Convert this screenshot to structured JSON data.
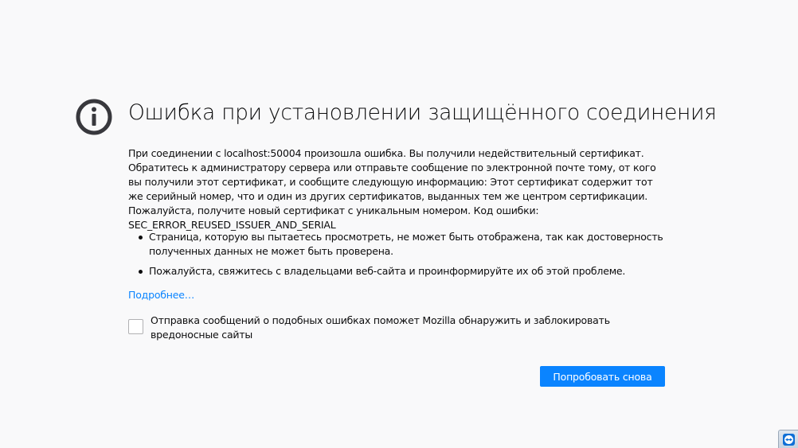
{
  "icon": "info-icon",
  "title": "Ошибка при установлении защищённого соединения",
  "description": "При соединении с localhost:50004 произошла ошибка. Вы получили недействительный сертификат. Обратитесь к администратору сервера или отправьте сообщение по электронной почте тому, от кого вы получили этот сертификат, и сообщите следующую информацию: Этот сертификат содержит тот же серийный номер, что и один из других сертификатов, выданных тем же центром сертификации. Пожалуйста, получите новый сертификат с уникальным номером. Код ошибки: SEC_ERROR_REUSED_ISSUER_AND_SERIAL",
  "reasons": [
    "Страница, которую вы пытаетесь просмотреть, не может быть отображена, так как достоверность полученных данных не может быть проверена.",
    "Пожалуйста, свяжитесь с владельцами веб-сайта и проинформируйте их об этой проблеме."
  ],
  "advanced_link": "Подробнее…",
  "report": {
    "checked": false,
    "label": "Отправка сообщений о подобных ошибках поможет Mozilla обнаружить и заблокировать вредоносные сайты"
  },
  "try_again_label": "Попробовать снова",
  "tray": {
    "icon": "teamviewer-icon"
  },
  "colors": {
    "background": "#f9f9fa",
    "accent": "#0a84ff",
    "icon": "#38383d"
  }
}
